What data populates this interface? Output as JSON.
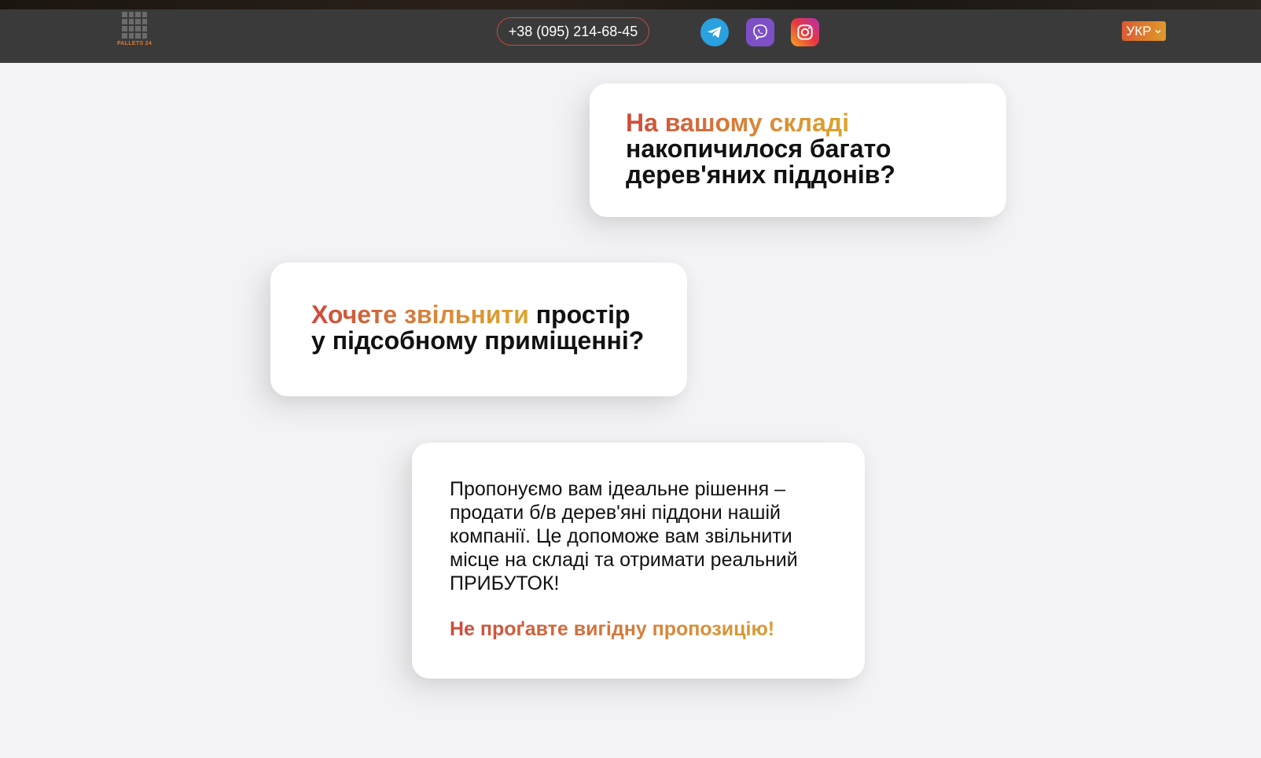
{
  "header": {
    "logo_text": "PALLETS 24",
    "phone": "+38 (095) 214-68-45",
    "social": [
      {
        "name": "telegram-icon",
        "color": "#2aa1e0"
      },
      {
        "name": "viber-icon",
        "color": "#7d50c7"
      },
      {
        "name": "instagram-icon",
        "color": "#e8383d"
      }
    ],
    "language": "УКР"
  },
  "cards": {
    "card1": {
      "accent": "На вашому складі",
      "rest": "накопичилося багато дерев'яних піддонів?"
    },
    "card2": {
      "accent": "Хочете звільнити",
      "rest": "простір у підсобному приміщенні?"
    },
    "card3": {
      "body": "Пропонуємо вам ідеальне рішення – продати б/в дерев'яні піддони нашій компанії. Це допоможе вам звільнити місце на складі та отримати реальний ПРИБУТОК!",
      "cta": "Не проґавте вигідну пропозицію!"
    }
  },
  "colors": {
    "header_bg": "#3a3a3a",
    "accent_start": "#cc4a3c",
    "accent_end": "#dba52c",
    "page_bg": "#f3f3f5"
  }
}
